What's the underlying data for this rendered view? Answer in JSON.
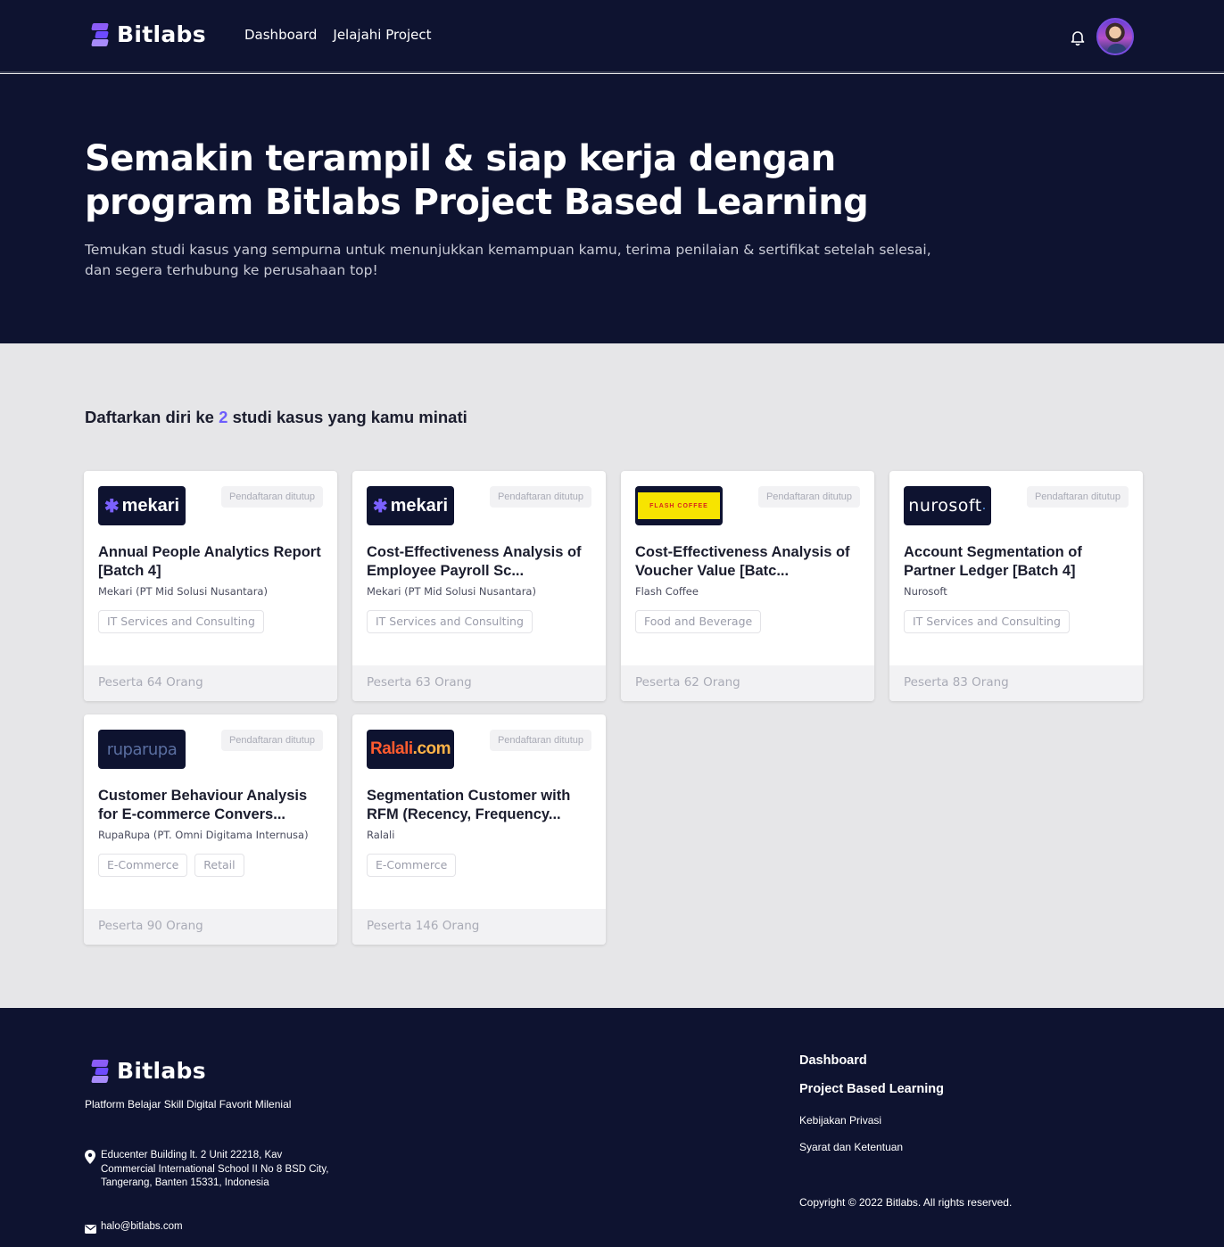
{
  "navbar": {
    "brand": "Bitlabs",
    "links": [
      "Dashboard",
      "Jelajahi Project"
    ],
    "icons": [
      "bell-icon",
      "user-avatar"
    ]
  },
  "hero": {
    "title": "Semakin terampil & siap kerja dengan program Bitlabs Project Based Learning",
    "subtitle": "Temukan studi kasus yang sempurna untuk menunjukkan kemampuan kamu, terima penilaian & sertifikat setelah selesai, dan segera terhubung ke perusahaan top!"
  },
  "section": {
    "title_prefix": "Daftarkan diri ke",
    "count": "2",
    "title_suffix": "studi kasus yang kamu minati"
  },
  "cards": [
    {
      "logo": {
        "type": "mekari",
        "text": "mekari"
      },
      "status": "Pendaftaran ditutup",
      "title": "Annual People Analytics Report [Batch 4]",
      "company": "Mekari (PT Mid Solusi Nusantara)",
      "tags": [
        "IT Services and Consulting"
      ],
      "participants": "Peserta 64 Orang"
    },
    {
      "logo": {
        "type": "mekari",
        "text": "mekari"
      },
      "status": "Pendaftaran ditutup",
      "title": "Cost-Effectiveness Analysis of Employee Payroll Sc...",
      "company": "Mekari (PT Mid Solusi Nusantara)",
      "tags": [
        "IT Services and Consulting"
      ],
      "participants": "Peserta 63 Orang"
    },
    {
      "logo": {
        "type": "flash",
        "text": "FLASH COFFEE"
      },
      "status": "Pendaftaran ditutup",
      "title": "Cost-Effectiveness Analysis of Voucher Value [Batc...",
      "company": "Flash Coffee",
      "tags": [
        "Food and Beverage"
      ],
      "participants": "Peserta 62 Orang"
    },
    {
      "logo": {
        "type": "nuro",
        "text": "nurosoft"
      },
      "status": "Pendaftaran ditutup",
      "title": "Account Segmentation of Partner Ledger [Batch 4]",
      "company": "Nurosoft",
      "tags": [
        "IT Services and Consulting"
      ],
      "participants": "Peserta 83 Orang"
    },
    {
      "logo": {
        "type": "ruparupa",
        "text": "ruparupa"
      },
      "status": "Pendaftaran ditutup",
      "title": "Customer Behaviour Analysis for E-commerce Convers...",
      "company": "RupaRupa (PT. Omni Digitama Internusa)",
      "tags": [
        "E-Commerce",
        "Retail"
      ],
      "participants": "Peserta 90 Orang"
    },
    {
      "logo": {
        "type": "ralali",
        "text1": "Ralali",
        "text2": ".com"
      },
      "status": "Pendaftaran ditutup",
      "title": "Segmentation Customer with RFM (Recency, Frequency...",
      "company": "Ralali",
      "tags": [
        "E-Commerce"
      ],
      "participants": "Peserta 146 Orang"
    }
  ],
  "footer": {
    "brand": "Bitlabs",
    "tagline": "Platform Belajar Skill Digital Favorit Milenial",
    "address": "Educenter Building lt. 2 Unit 22218, Kav Commercial International School II No 8 BSD City, Tangerang, Banten 15331, Indonesia",
    "email": "halo@bitlabs.com",
    "links_main": [
      "Dashboard",
      "Project Based Learning"
    ],
    "links_small": [
      "Kebijakan Privasi",
      "Syarat dan Ketentuan"
    ],
    "copyright": "Copyright © 2022 Bitlabs. All rights reserved."
  },
  "colors": {
    "navy": "#0e1330",
    "accent": "#6d5dfc",
    "page_bg": "#e6e6e8"
  }
}
